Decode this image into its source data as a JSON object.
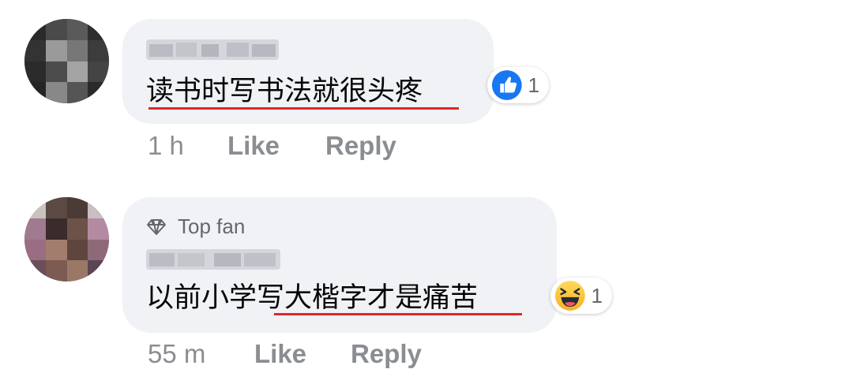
{
  "comments": [
    {
      "text": "读书时写书法就很头疼",
      "reaction_count": "1",
      "reaction_type": "like-icon",
      "time": "1 h",
      "like_label": "Like",
      "reply_label": "Reply"
    },
    {
      "badge": "Top fan",
      "text": "以前小学写大楷字才是痛苦",
      "reaction_count": "1",
      "reaction_type": "haha-icon",
      "time": "55 m",
      "like_label": "Like",
      "reply_label": "Reply"
    }
  ],
  "colors": {
    "bubble": "#f0f2f5",
    "underline": "#e0262a",
    "like_blue": "#1877f2",
    "meta_gray": "#8a8d91"
  }
}
